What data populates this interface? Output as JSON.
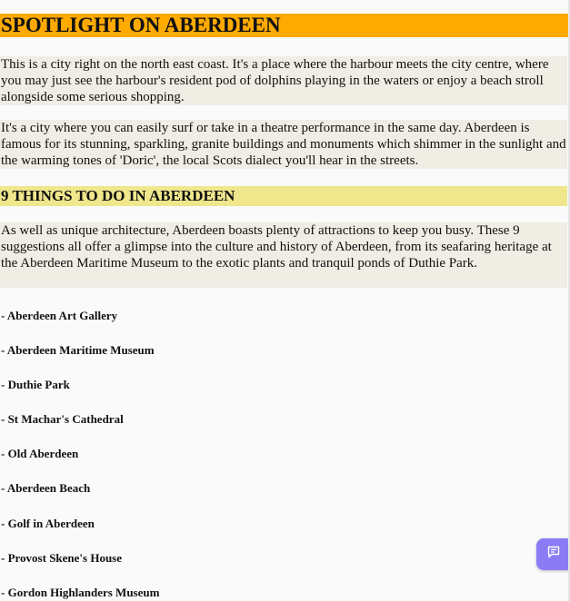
{
  "title": "SPOTLIGHT ON ABERDEEN",
  "intro": [
    "This is a city right on the north east coast. It's a place where the harbour meets the city centre, where you may just see the harbour's resident pod of dolphins playing in the waters or enjoy a beach stroll alongside some serious shopping.",
    "It's a city where you can easily surf or take in a theatre performance in the same day. Aberdeen is famous for its stunning, sparkling, granite buildings and monuments which shimmer in the sunlight and the warming tones of 'Doric', the local Scots dialect you'll hear in the streets."
  ],
  "section": {
    "heading": "9 THINGS TO DO IN ABERDEEN",
    "text": "As well as unique architecture, Aberdeen boasts plenty of attractions to keep you busy. These 9 suggestions all offer a glimpse into the culture and history of Aberdeen, from its seafaring heritage at the Aberdeen Maritime Museum to the exotic plants and tranquil ponds of Duthie Park."
  },
  "things": [
    "- Aberdeen Art Gallery",
    "- Aberdeen Maritime Museum",
    "- Duthie Park",
    "- St Machar's Cathedral",
    "- Old Aberdeen",
    "- Aberdeen Beach",
    "- Golf in Aberdeen",
    "- Provost Skene's House",
    "- Gordon Highlanders Museum"
  ],
  "chat_widget": {
    "icon": "chat-bubble-icon",
    "color": "#8b7cf6"
  },
  "colors": {
    "title_bg": "#ffaa00",
    "section_heading_bg": "#f0e68c",
    "paragraph_bg": "#efede4"
  }
}
